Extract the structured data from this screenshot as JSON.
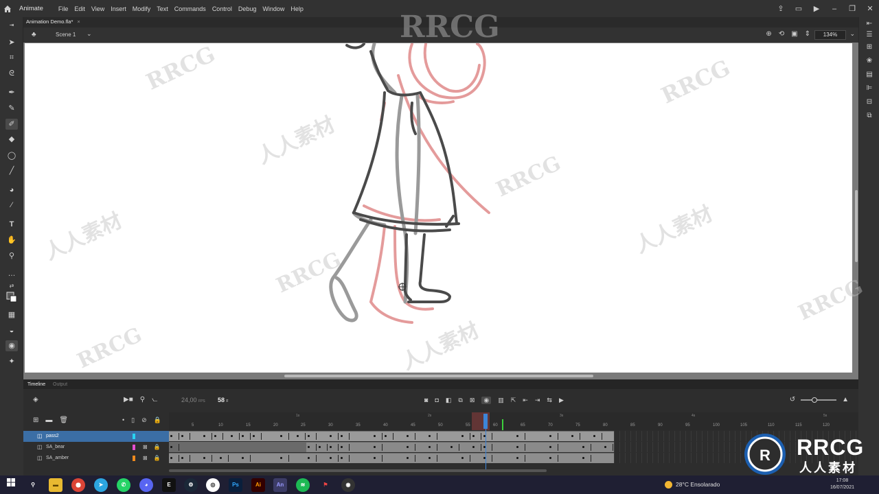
{
  "app": {
    "name": "Animate"
  },
  "menu": [
    "File",
    "Edit",
    "View",
    "Insert",
    "Modify",
    "Text",
    "Commands",
    "Control",
    "Debug",
    "Window",
    "Help"
  ],
  "document": {
    "tab_title": "Animation Demo.fla*",
    "close": "×"
  },
  "scene": {
    "label": "Scene 1",
    "zoom": "134%"
  },
  "timeline": {
    "tabs": {
      "timeline": "Timeline",
      "output": "Output"
    },
    "fps_value": "24,00",
    "fps_unit": "FPS",
    "current_frame": "58",
    "frame_unit": "F",
    "seconds": [
      "1s",
      "2s",
      "3s",
      "4s",
      "5s"
    ],
    "ticks": [
      "5",
      "10",
      "15",
      "20",
      "25",
      "30",
      "35",
      "40",
      "45",
      "50",
      "55",
      "60",
      "65",
      "70",
      "75",
      "80",
      "85",
      "90",
      "95",
      "100",
      "105",
      "110",
      "115",
      "120"
    ],
    "layers": [
      {
        "name": "pass2",
        "color": "#29d3f2",
        "selected": true
      },
      {
        "name": "SA_bear",
        "color": "#e64ed0",
        "selected": false
      },
      {
        "name": "SA_amber",
        "color": "#f08a1e",
        "selected": false
      }
    ]
  },
  "watermarks": {
    "brand": "RRCG",
    "cn": "人人素材"
  },
  "logo": {
    "brand": "RRCG",
    "cn": "人人素材"
  },
  "taskbar": {
    "weather": "28°C  Ensolarado",
    "time": "17:08",
    "date": "16/07/2021",
    "apps": [
      {
        "label": "Ps",
        "color": "#0a1f3c",
        "text_color": "#31a8ff"
      },
      {
        "label": "Ai",
        "color": "#330000",
        "text_color": "#ff9a00"
      },
      {
        "label": "An",
        "color": "#1e1a55",
        "text_color": "#9999ff"
      }
    ]
  },
  "colors": {
    "accent": "#3d85d8",
    "selected_layer": "#3b6ea5",
    "stage": "#ffffff"
  }
}
